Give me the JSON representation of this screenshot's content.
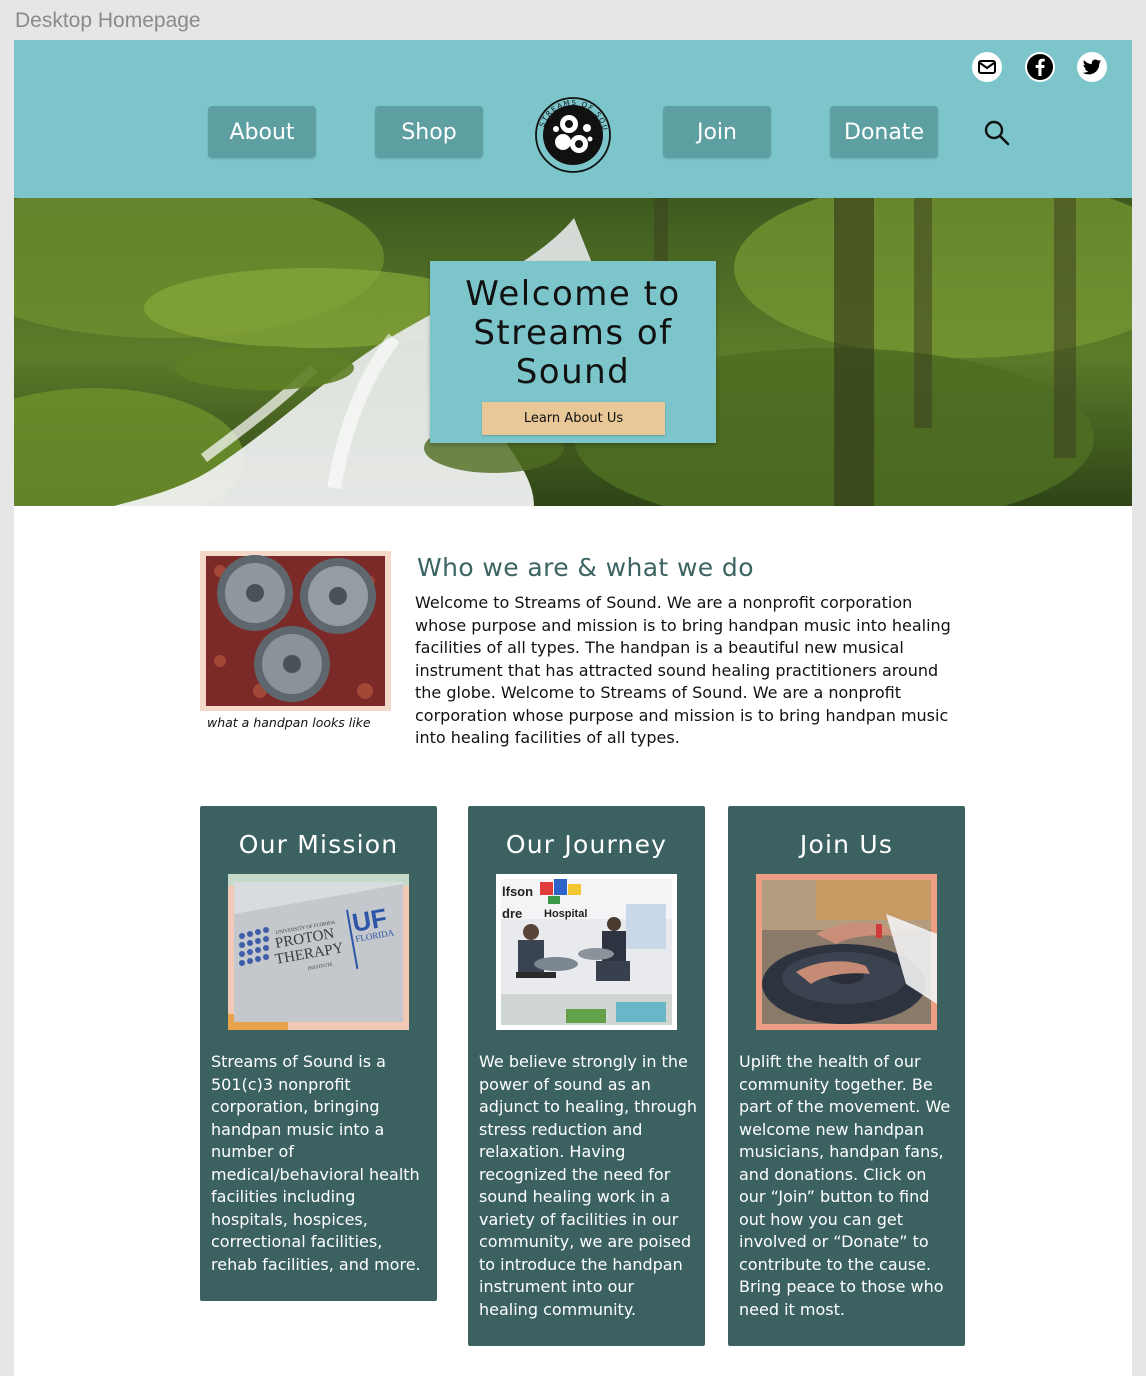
{
  "frame": {
    "label": "Desktop Homepage"
  },
  "colors": {
    "header_bg": "#7cc6cb",
    "nav_button_bg": "#5e9fa2",
    "cta_bg": "#e8c896",
    "card_bg": "#3b6260",
    "heading_color": "#3c6462"
  },
  "header": {
    "social": [
      {
        "icon": "mail-icon"
      },
      {
        "icon": "facebook-icon"
      },
      {
        "icon": "twitter-icon"
      }
    ],
    "nav": {
      "about": "About",
      "shop": "Shop",
      "join": "Join",
      "donate": "Donate"
    },
    "logo_text": "STREAMS OF SOUND",
    "search_icon": "search-icon"
  },
  "hero": {
    "title": "Welcome to\nStreams of\nSound",
    "cta": "Learn About Us"
  },
  "about": {
    "image_caption": "what a handpan looks like",
    "heading": "Who we are & what we do",
    "body": "Welcome to Streams of Sound. We are a nonprofit corporation whose purpose and mission is to bring handpan music into healing facilities of all types. The handpan is a beautiful new musical instrument that has attracted sound healing practitioners around the globe. Welcome to Streams of Sound. We are a nonprofit corporation whose purpose and mission is to bring handpan music into healing facilities of all types."
  },
  "cards": [
    {
      "title": "Our Mission",
      "body": "Streams of Sound is a 501(c)3 nonprofit corporation, bringing handpan music into a number of medical/behavioral health facilities including hospitals, hospices, correctional facilities, rehab facilities, and more."
    },
    {
      "title": "Our Journey",
      "body": "We believe strongly in the power of sound as an adjunct to healing, through stress reduction and relaxation. Having recognized the need for sound healing work in a variety of facilities in our community, we are poised to introduce the handpan instrument into our healing community."
    },
    {
      "title": "Join Us",
      "body": "Uplift the health of our community together. Be part of the movement. We welcome new handpan musicians, handpan fans, and donations. Click on our “Join” button to find out how you can get involved or “Donate” to contribute to the cause. Bring peace to those who need it most."
    }
  ],
  "images": {
    "mission_sign": {
      "line1": "UNIVERSITY OF FLORIDA",
      "line2": "PROTON",
      "line3": "THERAPY",
      "line4": "INSTITUTE",
      "uf": "UF",
      "florida": "FLORIDA"
    },
    "journey_sign": {
      "line1": "lfson",
      "line2": "dre",
      "line3": "Hospital"
    }
  }
}
